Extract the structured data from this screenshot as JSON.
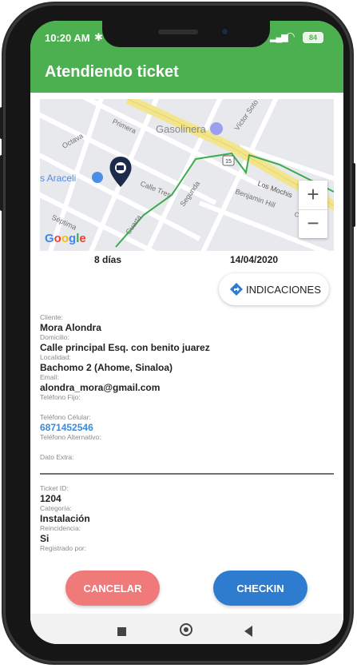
{
  "status_bar": {
    "time": "10:20 AM",
    "battery": "84"
  },
  "app_bar": {
    "title": "Atendiendo ticket"
  },
  "map": {
    "labels": [
      "Gasolinera",
      "Primera",
      "Octava",
      "s Araceli",
      "Calle Tres",
      "Segunda",
      "Cuarta",
      "Séptima",
      "Víctor Soto",
      "Los Mochis",
      "Benjamin Hill",
      "Culiacán",
      "15"
    ],
    "zoom_in": "+",
    "zoom_out": "−",
    "logo": {
      "g": "G",
      "o1": "o",
      "o2": "o",
      "g2": "g",
      "l": "l",
      "e": "e"
    }
  },
  "summary": {
    "days": "8 días",
    "date": "14/04/2020"
  },
  "directions_button": {
    "label": "INDICACIONES"
  },
  "client": {
    "cliente_label": "Cliente:",
    "cliente": "Mora Alondra",
    "domicilio_label": "Domicilio:",
    "domicilio": "Calle principal Esq. con benito juarez",
    "localidad_label": "Localidad:",
    "localidad": "Bachomo 2 (Ahome, Sinaloa)",
    "email_label": "Email:",
    "email": "alondra_mora@gmail.com",
    "tel_fijo_label": "Teléfono Fijo:",
    "tel_celular_label": "Teléfono Célular:",
    "tel_celular": "6871452546",
    "tel_alt_label": "Teléfono Alternativo:",
    "dato_extra_label": "Dato Extra:"
  },
  "ticket": {
    "id_label": "Ticket ID:",
    "id": "1204",
    "categoria_label": "Categoría:",
    "categoria": "Instalación",
    "reincidencia_label": "Reincidencia:",
    "reincidencia": "Si",
    "registrado_label": "Registrado por:"
  },
  "actions": {
    "cancel": "CANCELAR",
    "checkin": "CHECKIN"
  },
  "colors": {
    "primary": "#4caf50",
    "cancel": "#f07a7a",
    "checkin": "#2e7ccf",
    "link": "#3b8ad9"
  }
}
